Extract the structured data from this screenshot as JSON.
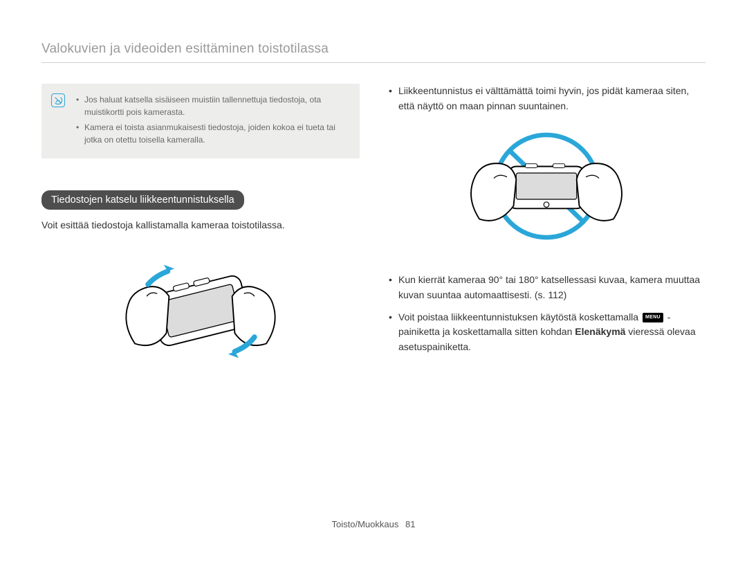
{
  "page_title": "Valokuvien ja videoiden esittäminen toistotilassa",
  "note": {
    "items": [
      "Jos haluat katsella sisäiseen muistiin tallennettuja tiedostoja, ota muistikortti pois kamerasta.",
      "Kamera ei toista asianmukaisesti tiedostoja, joiden kokoa ei tueta tai jotka on otettu toisella kameralla."
    ]
  },
  "left": {
    "sub_heading": "Tiedostojen katselu liikkeentunnistuksella",
    "intro": "Voit esittää tiedostoja kallistamalla kameraa toistotilassa."
  },
  "right": {
    "first_bullet": "Liikkeentunnistus ei välttämättä toimi hyvin, jos pidät kameraa siten, että näyttö on maan pinnan suuntainen.",
    "second_bullet": "Kun kierrät kameraa 90° tai 180° katsellessasi kuvaa, kamera muuttaa kuvan suuntaa automaattisesti. (s. 112)",
    "third_bullet_pre": "Voit poistaa liikkeentunnistuksen käytöstä koskettamalla ",
    "menu_label": "MENU",
    "third_bullet_mid": " -painiketta ja koskettamalla sitten kohdan ",
    "third_bullet_bold": "Elenäkymä",
    "third_bullet_post": " vieressä olevaa asetuspainiketta."
  },
  "footer": {
    "label": "Toisto/Muokkaus",
    "page_num": "81"
  }
}
